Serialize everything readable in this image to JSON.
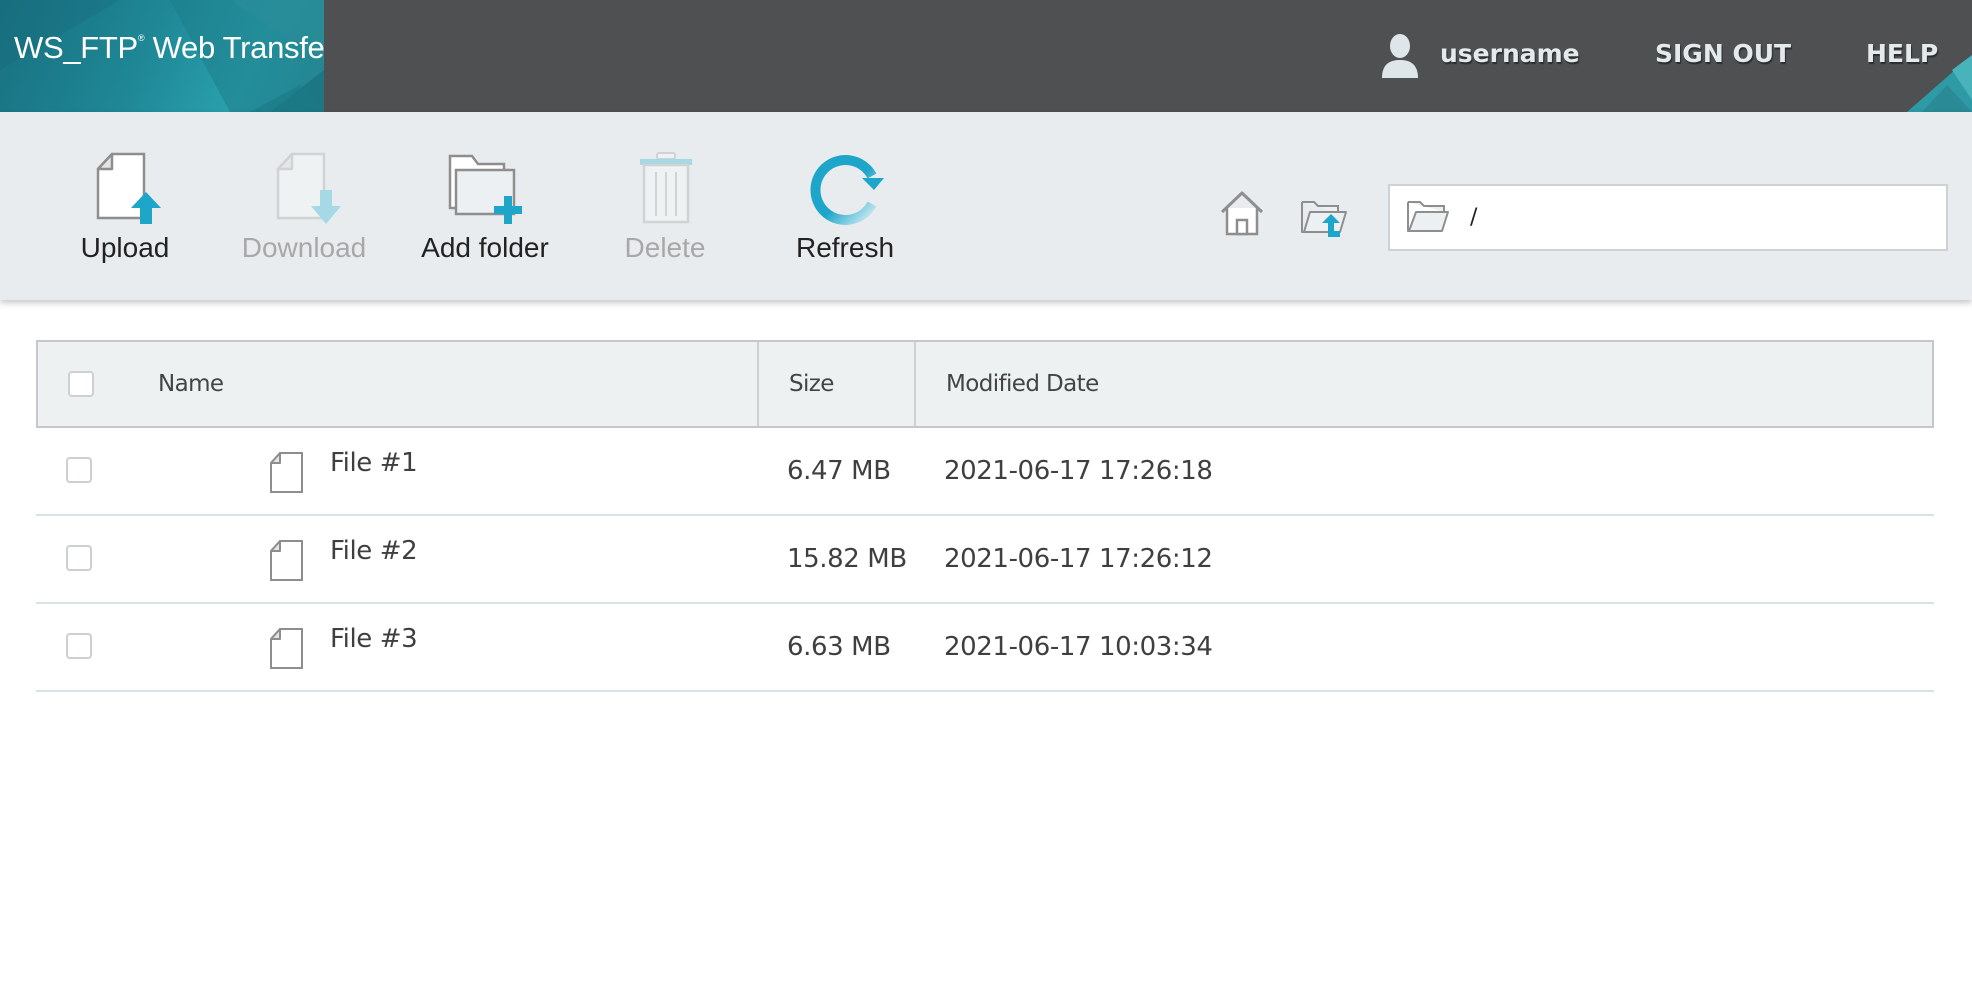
{
  "header": {
    "app_title": "WS_FTP",
    "app_title_reg": "®",
    "app_subtitle": "Web Transfer",
    "user_icon": "user-icon",
    "username": "username",
    "sign_out_label": "SIGN OUT",
    "help_label": "HELP"
  },
  "toolbar": {
    "buttons": [
      {
        "id": "upload",
        "label": "Upload",
        "icon": "file-upload-icon",
        "enabled": true
      },
      {
        "id": "download",
        "label": "Download",
        "icon": "file-download-icon",
        "enabled": false
      },
      {
        "id": "add_folder",
        "label": "Add folder",
        "icon": "folder-add-icon",
        "enabled": true
      },
      {
        "id": "delete",
        "label": "Delete",
        "icon": "trash-icon",
        "enabled": false
      },
      {
        "id": "refresh",
        "label": "Refresh",
        "icon": "refresh-icon",
        "enabled": true
      }
    ],
    "home_icon": "home-icon",
    "parent_folder_icon": "folder-up-icon",
    "path": {
      "icon": "folder-open-icon",
      "value": "/"
    }
  },
  "table": {
    "columns": [
      "Name",
      "Size",
      "Modified Date"
    ],
    "rows": [
      {
        "name": "File #1",
        "size": "6.47 MB",
        "modified": "2021-06-17 17:26:18",
        "selected": false
      },
      {
        "name": "File #2",
        "size": "15.82 MB",
        "modified": "2021-06-17 17:26:12",
        "selected": false
      },
      {
        "name": "File #3",
        "size": "6.63 MB",
        "modified": "2021-06-17 10:03:34",
        "selected": false
      }
    ]
  },
  "colors": {
    "accent": "#1da6c9",
    "topbar": "#4f5052",
    "toolbar": "#e9ecee",
    "logo": "#1f8796"
  }
}
